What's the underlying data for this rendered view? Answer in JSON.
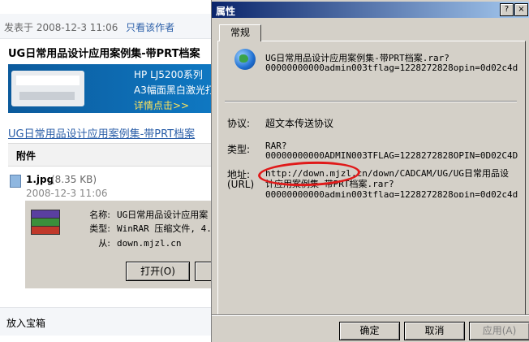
{
  "post": {
    "posted_on_label": "发表于",
    "posted_on_date": "2008-12-3 11:06",
    "author_only_link": "只看该作者",
    "title": "UG日常用品设计应用案例集-带PRT档案",
    "ad": {
      "line1": "HP LJ5200系列",
      "line2": "A3幅面黑白激光打",
      "line3": "详情点击>>"
    },
    "link_text": "UG日常用品设计应用案例集-带PRT档案"
  },
  "attachment": {
    "header": "附件",
    "file_name": "1.jpg",
    "file_size": "(8.35 KB)",
    "file_date": "2008-12-3 11:06"
  },
  "download_panel": {
    "name_label": "名称:",
    "name_value": "UG日常用品设计应用案",
    "type_label": "类型:",
    "type_value": "WinRAR 压缩文件, 4.",
    "from_label": "从:",
    "from_value": "down.mjzl.cn",
    "open_button": "打开(O)"
  },
  "favorite_bar": {
    "label": "放入宝箱"
  },
  "dialog": {
    "title": "属性",
    "help_glyph": "?",
    "close_glyph": "×",
    "tab_general": "常规",
    "filename_line1": "UG日常用品设计应用案例集-带PRT档案.rar?",
    "filename_line2": "00000000000admin003tflag=1228272828opin=0d02c4d",
    "protocol_label": "协议:",
    "protocol_value": "超文本传送协议",
    "type_label": "类型:",
    "type_line1": "RAR?",
    "type_line2": "00000000000ADMIN003TFLAG=1228272828OPIN=0D02C4D",
    "address_label": "地址:",
    "url_label": "(URL)",
    "address_line1": "http://down.mjzl.cn/down/CADCAM/UG/UG日常用品设",
    "address_line2": "计应用案例集-带PRT档案.rar?",
    "address_line3": "00000000000admin003tflag=1228272828opin=0d02c4d",
    "ok_button": "确定",
    "cancel_button": "取消",
    "apply_button": "应用(A)"
  },
  "colors": {
    "titlebar_start": "#0a246a",
    "titlebar_end": "#a6caf0",
    "dialog_face": "#d4d0c8",
    "highlight_circle": "#e01a1a",
    "link_blue": "#2a5ea8"
  }
}
